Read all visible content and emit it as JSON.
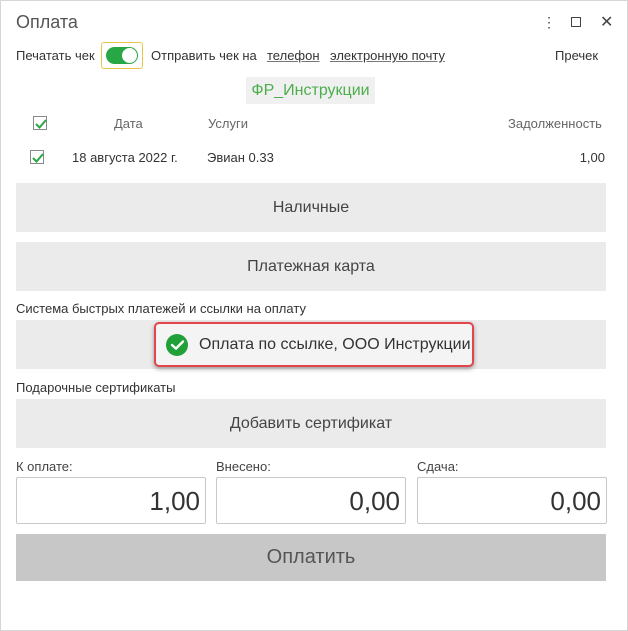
{
  "window": {
    "title": "Оплата"
  },
  "receipt": {
    "print_label": "Печатать чек",
    "print_enabled": true,
    "send_label": "Отправить чек на",
    "phone_link": "телефон",
    "email_link": "электронную почту",
    "other_link": "Пречек"
  },
  "fiscal_register": "ФР_Инструкции",
  "table": {
    "columns": [
      "Дата",
      "Услуги",
      "Задолженность"
    ],
    "rows": [
      {
        "checked": true,
        "date": "18 августа 2022 г.",
        "service": "Эвиан 0.33",
        "debt": "1,00"
      }
    ]
  },
  "buttons": {
    "cash": "Наличные",
    "card": "Платежная карта",
    "pay": "Оплатить"
  },
  "sbp": {
    "section_label": "Система быстрых платежей и ссылки на оплату",
    "button_label": "Оплата по ссылке, ООО Инструкции"
  },
  "gift": {
    "section_label": "Подарочные сертификаты",
    "add_button": "Добавить сертификат"
  },
  "totals": {
    "to_pay_label": "К оплате:",
    "to_pay": "1,00",
    "paid_label": "Внесено:",
    "paid": "0,00",
    "change_label": "Сдача:",
    "change": "0,00"
  },
  "colors": {
    "accent": "#28a745",
    "highlight_border": "#e2464c",
    "sber_green": "#21a038"
  }
}
